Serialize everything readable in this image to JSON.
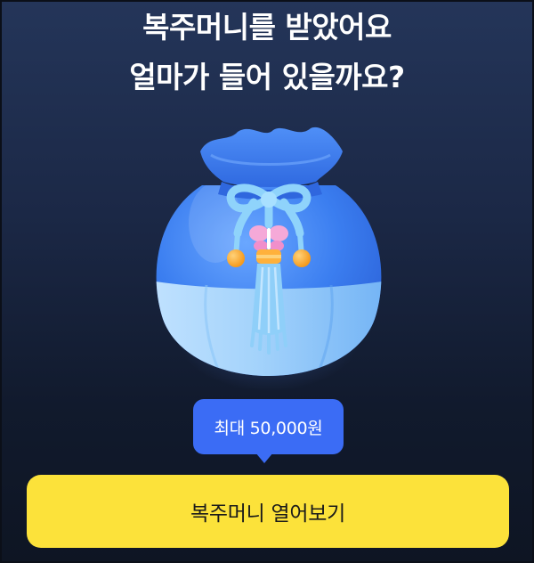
{
  "headline": {
    "line1": "복주머니를 받았어요",
    "line2": "얼마가 들어 있을까요?"
  },
  "pouch": {
    "icon": "lucky-pouch-illustration",
    "colors": {
      "body": "#3e83f2",
      "ruffle": "#3f7ff0",
      "lower_panel": "#a9d6fb",
      "knot": "#8fd0fb",
      "bead": "#ffb13b",
      "butterfly": "#f5a9d8"
    }
  },
  "tooltip": {
    "text": "최대 50,000원",
    "color": "#3b6cf5"
  },
  "cta": {
    "label": "복주머니 열어보기",
    "color": "#fce23a"
  },
  "theme": {
    "background_top": "#243559",
    "background_bottom": "#0e1523"
  }
}
